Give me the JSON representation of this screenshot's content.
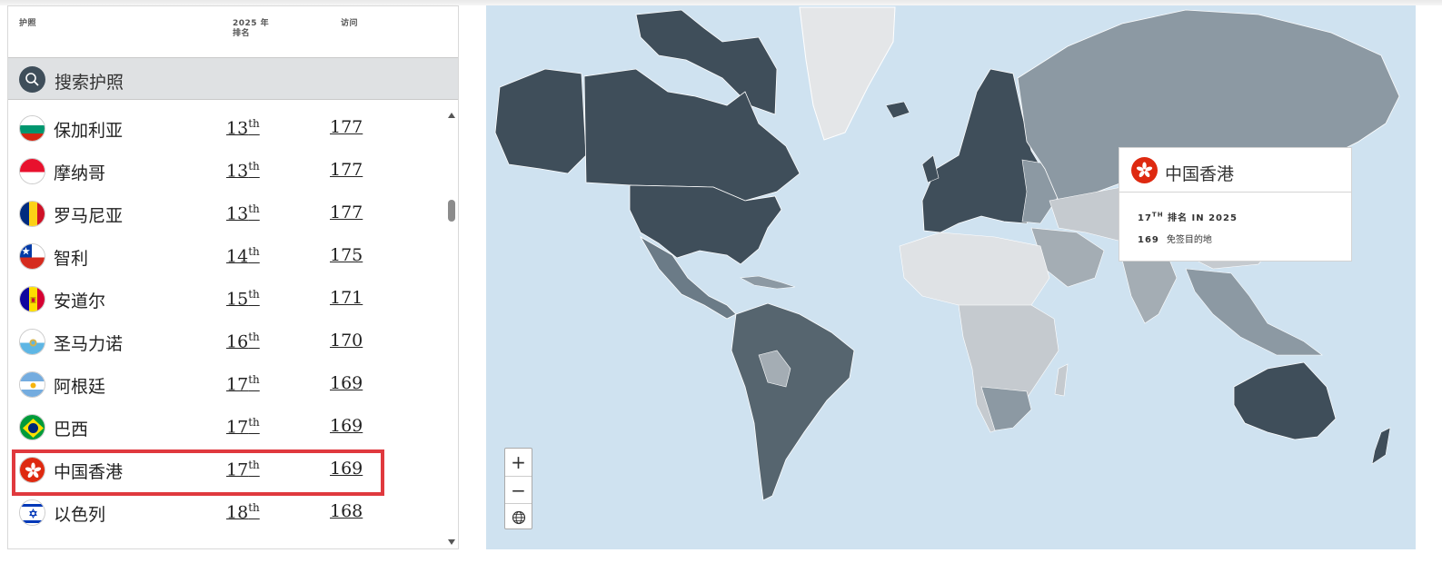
{
  "table": {
    "col_passport": "护照",
    "col_rank_year": "2025 年",
    "col_rank_label": "排名",
    "col_visits": "访问",
    "search_label": "搜索护照"
  },
  "rows": [
    {
      "name": "保加利亚",
      "rank": "13",
      "suffix": "th",
      "visits": "177",
      "flag": "bulgaria-flag-icon"
    },
    {
      "name": "摩纳哥",
      "rank": "13",
      "suffix": "th",
      "visits": "177",
      "flag": "monaco-flag-icon"
    },
    {
      "name": "罗马尼亚",
      "rank": "13",
      "suffix": "th",
      "visits": "177",
      "flag": "romania-flag-icon"
    },
    {
      "name": "智利",
      "rank": "14",
      "suffix": "th",
      "visits": "175",
      "flag": "chile-flag-icon"
    },
    {
      "name": "安道尔",
      "rank": "15",
      "suffix": "th",
      "visits": "171",
      "flag": "andorra-flag-icon"
    },
    {
      "name": "圣马力诺",
      "rank": "16",
      "suffix": "th",
      "visits": "170",
      "flag": "san-marino-flag-icon"
    },
    {
      "name": "阿根廷",
      "rank": "17",
      "suffix": "th",
      "visits": "169",
      "flag": "argentina-flag-icon"
    },
    {
      "name": "巴西",
      "rank": "17",
      "suffix": "th",
      "visits": "169",
      "flag": "brazil-flag-icon"
    },
    {
      "name": "中国香港",
      "rank": "17",
      "suffix": "th",
      "visits": "169",
      "flag": "hong-kong-flag-icon"
    },
    {
      "name": "以色列",
      "rank": "18",
      "suffix": "th",
      "visits": "168",
      "flag": "israel-flag-icon"
    }
  ],
  "tooltip": {
    "title": "中国香港",
    "rank_num": "17",
    "rank_suffix": "TH",
    "rank_text": "排名 IN 2025",
    "visa_free_count": "169",
    "visa_free_label": "免签目的地"
  },
  "zoom": {
    "plus": "+",
    "minus": "−"
  },
  "colors": {
    "highlight": "#e0393e",
    "map_water": "#cfe2f0",
    "map_dark": "#3f4e5a",
    "map_mid": "#8c99a3",
    "map_light": "#c5cacf",
    "map_pale": "#e4e6e8"
  }
}
